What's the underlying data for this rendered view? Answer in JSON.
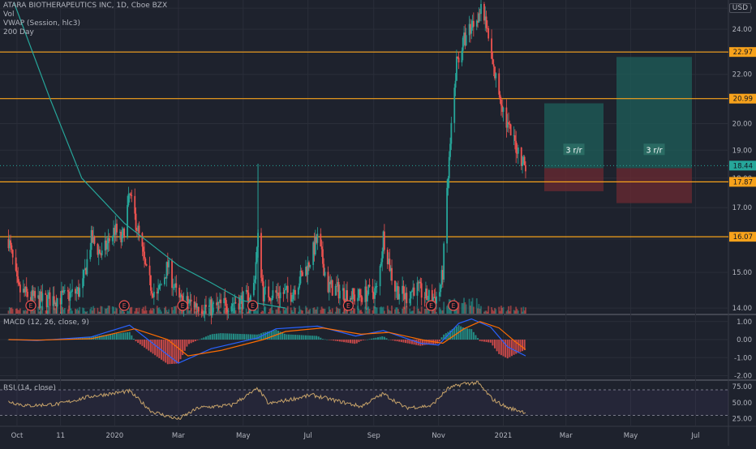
{
  "header": {
    "symbol_line": "ATARA BIOTHERAPEUTICS INC, 1D, Cboe BZX",
    "indicators": [
      "Vol",
      "VWAP (Session, hlc3)",
      "200 Day"
    ],
    "unit_button": "USD"
  },
  "macd": {
    "label": "MACD (12, 26, close, 9)"
  },
  "rsi": {
    "label": "RSI (14, close)"
  },
  "colors": {
    "background": "#1e222d",
    "grid": "#2a2e39",
    "up": "#26a69a",
    "down": "#ef5350",
    "level": "#f7a21b",
    "ma200": "#26a69a",
    "macd": "#2962ff",
    "signal": "#ff6d00",
    "rsi": "#c7a36a",
    "profit_zone": "#1e5f5a",
    "loss_zone": "#6b2a31"
  },
  "chart_data": [
    {
      "type": "candlestick",
      "y_axis": {
        "ticks": [
          "25.00",
          "24.00",
          "23.00",
          "22.00",
          "21.00",
          "20.00",
          "19.00",
          "18.00",
          "17.00",
          "16.00",
          "15.00",
          "14.00"
        ],
        "scale": "log",
        "range": [
          13.85,
          25.4
        ]
      },
      "x_axis": {
        "ticks": [
          "Oct",
          "11",
          "2020",
          "Mar",
          "May",
          "Jul",
          "Sep",
          "Nov",
          "2021",
          "Mar",
          "May",
          "Jul"
        ]
      },
      "price_labels": [
        {
          "value": "22.97",
          "kind": "horizontal-level"
        },
        {
          "value": "20.99",
          "kind": "horizontal-level"
        },
        {
          "value": "18.44",
          "kind": "last-price"
        },
        {
          "value": "17.87",
          "kind": "horizontal-level"
        },
        {
          "value": "16.07",
          "kind": "horizontal-level"
        }
      ],
      "horizontal_levels": [
        22.97,
        20.99,
        17.87,
        16.07
      ],
      "last_price": 18.44,
      "risk_reward_boxes": [
        {
          "label": "3 r/r",
          "target": 20.8,
          "entry": 18.35,
          "stop": 17.55
        },
        {
          "label": "3 r/r",
          "target": 22.75,
          "entry": 18.35,
          "stop": 17.15
        }
      ],
      "earnings_markers": [
        "E",
        "E",
        "E",
        "E",
        "E",
        "E",
        "E"
      ],
      "price_path": [
        [
          "2019-09-23",
          16.0
        ],
        [
          "2019-10-02",
          14.5
        ],
        [
          "2019-10-20",
          14.2
        ],
        [
          "2019-11-15",
          14.3
        ],
        [
          "2019-12-01",
          14.5
        ],
        [
          "2019-12-10",
          16.0
        ],
        [
          "2019-12-20",
          15.5
        ],
        [
          "2020-01-01",
          16.3
        ],
        [
          "2020-01-08",
          15.9
        ],
        [
          "2020-01-15",
          17.4
        ],
        [
          "2020-01-22",
          16.4
        ],
        [
          "2020-02-01",
          14.8
        ],
        [
          "2020-02-10",
          14.3
        ],
        [
          "2020-02-20",
          15.2
        ],
        [
          "2020-03-01",
          14.2
        ],
        [
          "2020-04-01",
          14.0
        ],
        [
          "2020-05-10",
          14.3
        ],
        [
          "2020-05-15",
          16.0
        ],
        [
          "2020-05-20",
          14.4
        ],
        [
          "2020-06-15",
          14.4
        ],
        [
          "2020-07-01",
          15.2
        ],
        [
          "2020-07-10",
          16.0
        ],
        [
          "2020-07-20",
          14.6
        ],
        [
          "2020-08-15",
          14.3
        ],
        [
          "2020-09-05",
          14.5
        ],
        [
          "2020-09-10",
          16.1
        ],
        [
          "2020-09-20",
          14.6
        ],
        [
          "2020-10-01",
          14.3
        ],
        [
          "2020-10-10",
          14.6
        ],
        [
          "2020-10-20",
          14.3
        ],
        [
          "2020-11-01",
          14.3
        ],
        [
          "2020-11-05",
          15.0
        ],
        [
          "2020-11-10",
          18.0
        ],
        [
          "2020-11-18",
          22.5
        ],
        [
          "2020-11-25",
          23.5
        ],
        [
          "2020-12-02",
          24.2
        ],
        [
          "2020-12-10",
          24.9
        ],
        [
          "2020-12-15",
          24.4
        ],
        [
          "2020-12-22",
          22.3
        ],
        [
          "2020-12-28",
          21.3
        ],
        [
          "2021-01-04",
          20.0
        ],
        [
          "2021-01-10",
          19.4
        ],
        [
          "2021-01-15",
          19.0
        ],
        [
          "2021-01-22",
          18.4
        ]
      ],
      "ma200_path": [
        [
          "2019-09-28",
          25.3
        ],
        [
          "2019-11-01",
          21.0
        ],
        [
          "2019-12-01",
          18.0
        ],
        [
          "2020-01-10",
          16.5
        ],
        [
          "2020-03-01",
          15.2
        ],
        [
          "2020-04-01",
          14.7
        ],
        [
          "2020-05-01",
          14.2
        ],
        [
          "2020-06-10",
          14.0
        ]
      ],
      "volume_note": "volume bars along bottom of price pane; spike near 2020-05-15"
    },
    {
      "type": "line",
      "name": "MACD (12, 26, close, 9)",
      "y_axis": {
        "ticks": [
          "1.00",
          "0.00",
          "-1.00",
          "-2.00"
        ],
        "range": [
          -2.2,
          1.35
        ]
      },
      "macd_line": [
        [
          "2019-09-23",
          0.0
        ],
        [
          "2019-10-20",
          -0.05
        ],
        [
          "2019-12-10",
          0.15
        ],
        [
          "2020-01-15",
          0.8
        ],
        [
          "2020-02-10",
          -0.4
        ],
        [
          "2020-03-01",
          -1.3
        ],
        [
          "2020-04-01",
          -0.5
        ],
        [
          "2020-05-15",
          0.1
        ],
        [
          "2020-06-01",
          0.6
        ],
        [
          "2020-07-10",
          0.75
        ],
        [
          "2020-08-15",
          0.2
        ],
        [
          "2020-09-10",
          0.5
        ],
        [
          "2020-10-15",
          -0.2
        ],
        [
          "2020-11-01",
          -0.3
        ],
        [
          "2020-11-20",
          0.9
        ],
        [
          "2020-12-02",
          1.15
        ],
        [
          "2020-12-20",
          0.7
        ],
        [
          "2021-01-05",
          -0.4
        ],
        [
          "2021-01-22",
          -0.9
        ]
      ],
      "signal_line": [
        [
          "2019-09-23",
          0.0
        ],
        [
          "2019-10-20",
          -0.03
        ],
        [
          "2019-12-10",
          0.05
        ],
        [
          "2020-01-20",
          0.6
        ],
        [
          "2020-02-20",
          0.0
        ],
        [
          "2020-03-10",
          -0.9
        ],
        [
          "2020-04-10",
          -0.6
        ],
        [
          "2020-05-20",
          0.0
        ],
        [
          "2020-06-10",
          0.45
        ],
        [
          "2020-07-15",
          0.65
        ],
        [
          "2020-08-20",
          0.3
        ],
        [
          "2020-09-15",
          0.4
        ],
        [
          "2020-10-20",
          -0.05
        ],
        [
          "2020-11-05",
          -0.2
        ],
        [
          "2020-11-25",
          0.6
        ],
        [
          "2020-12-10",
          1.0
        ],
        [
          "2020-12-28",
          0.65
        ],
        [
          "2021-01-12",
          -0.1
        ],
        [
          "2021-01-22",
          -0.55
        ]
      ]
    },
    {
      "type": "line",
      "name": "RSI (14, close)",
      "y_axis": {
        "ticks": [
          "75.00",
          "50.00",
          "25.00"
        ],
        "range": [
          18,
          84
        ]
      },
      "bands": [
        70,
        30
      ],
      "rsi_line": [
        [
          "2019-09-23",
          52
        ],
        [
          "2019-10-10",
          45
        ],
        [
          "2019-11-10",
          48
        ],
        [
          "2019-12-10",
          60
        ],
        [
          "2020-01-15",
          68
        ],
        [
          "2020-02-05",
          36
        ],
        [
          "2020-03-01",
          24
        ],
        [
          "2020-03-20",
          42
        ],
        [
          "2020-04-20",
          46
        ],
        [
          "2020-05-15",
          72
        ],
        [
          "2020-05-25",
          48
        ],
        [
          "2020-07-05",
          62
        ],
        [
          "2020-07-20",
          56
        ],
        [
          "2020-08-20",
          44
        ],
        [
          "2020-09-10",
          64
        ],
        [
          "2020-10-01",
          42
        ],
        [
          "2020-10-25",
          45
        ],
        [
          "2020-11-10",
          72
        ],
        [
          "2020-11-25",
          80
        ],
        [
          "2020-12-08",
          81
        ],
        [
          "2020-12-22",
          55
        ],
        [
          "2021-01-05",
          42
        ],
        [
          "2021-01-22",
          35
        ]
      ]
    }
  ]
}
